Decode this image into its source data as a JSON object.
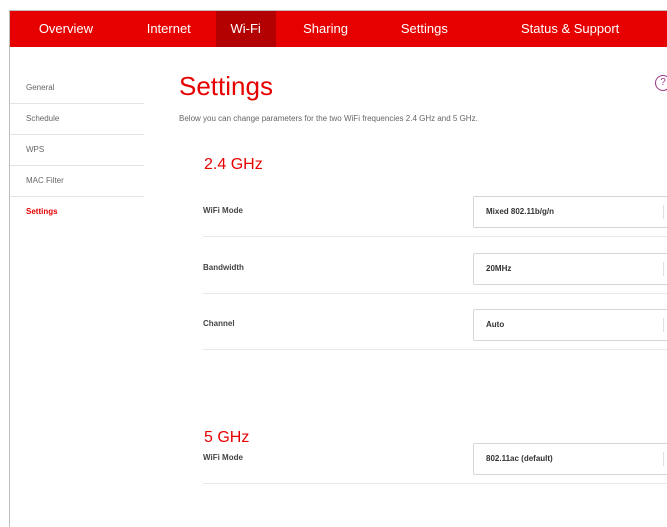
{
  "nav": {
    "tabs": [
      {
        "label": "Overview"
      },
      {
        "label": "Internet"
      },
      {
        "label": "Wi-Fi"
      },
      {
        "label": "Sharing"
      },
      {
        "label": "Settings"
      },
      {
        "label": "Status & Support"
      }
    ],
    "active_tab": "Wi-Fi"
  },
  "sidebar": {
    "items": [
      {
        "label": "General"
      },
      {
        "label": "Schedule"
      },
      {
        "label": "WPS"
      },
      {
        "label": "MAC Filter"
      },
      {
        "label": "Settings"
      }
    ],
    "active_item": "Settings"
  },
  "page": {
    "title": "Settings",
    "description": "Below you can change parameters for the two WiFi frequencies 2.4 GHz and 5 GHz.",
    "help_icon": "?"
  },
  "sections": [
    {
      "heading": "2.4 GHz",
      "rows": [
        {
          "label": "WiFi Mode",
          "value": "Mixed 802.11b/g/n"
        },
        {
          "label": "Bandwidth",
          "value": "20MHz"
        },
        {
          "label": "Channel",
          "value": "Auto"
        }
      ]
    },
    {
      "heading": "5 GHz",
      "rows": [
        {
          "label": "WiFi Mode",
          "value": "802.11ac (default)"
        }
      ]
    }
  ],
  "colors": {
    "brand": "#e60000",
    "brand_active": "#b30000"
  },
  "icons": {
    "help": "help-circle-icon",
    "select_arrow": "chevron-down-icon"
  }
}
